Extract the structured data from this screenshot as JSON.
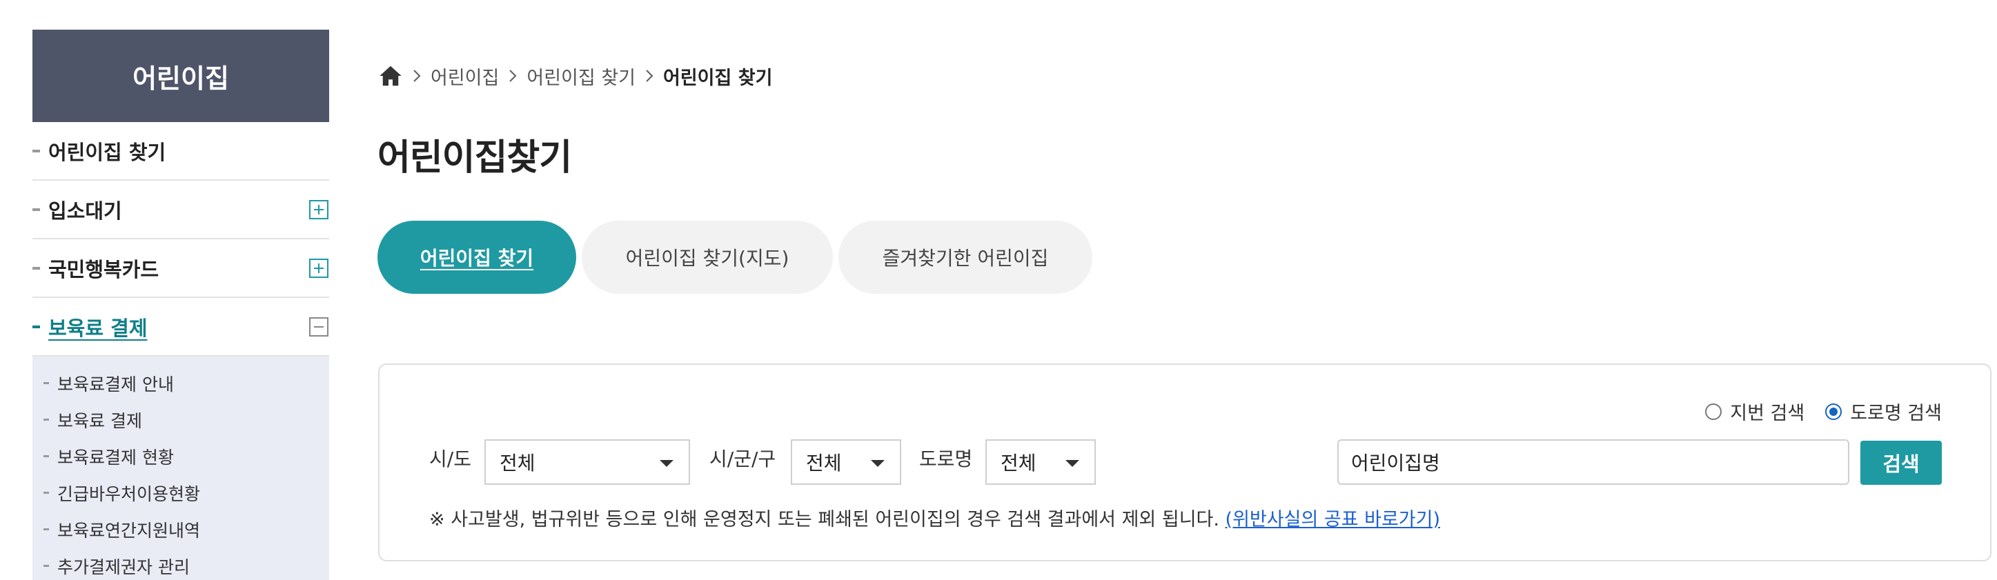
{
  "sidebar": {
    "title": "어린이집",
    "items": [
      {
        "label": "어린이집 찾기"
      },
      {
        "label": "입소대기"
      },
      {
        "label": "국민행복카드"
      },
      {
        "label": "보육료 결제"
      }
    ],
    "submenu": [
      {
        "label": "보육료결제 안내"
      },
      {
        "label": "보육료 결제"
      },
      {
        "label": "보육료결제 현황"
      },
      {
        "label": "긴급바우처이용현황"
      },
      {
        "label": "보육료연간지원내역"
      },
      {
        "label": "추가결제권자 관리"
      }
    ]
  },
  "breadcrumb": {
    "items": [
      "어린이집",
      "어린이집 찾기",
      "어린이집 찾기"
    ]
  },
  "page": {
    "title": "어린이집찾기"
  },
  "tabs": [
    {
      "label": "어린이집 찾기"
    },
    {
      "label": "어린이집 찾기(지도)"
    },
    {
      "label": "즐겨찾기한 어린이집"
    }
  ],
  "search": {
    "radio_lot": "지번 검색",
    "radio_road": "도로명 검색",
    "sido_label": "시/도",
    "sido_value": "전체",
    "sigungu_label": "시/군/구",
    "sigungu_value": "전체",
    "road_label": "도로명",
    "road_value": "전체",
    "name_value": "어린이집명",
    "button": "검색",
    "notice_text": "※ 사고발생, 법규위반 등으로 인해 운영정지 또는 폐쇄된 어린이집의 경우 검색 결과에서 제외 됩니다. ",
    "notice_link": "(위반사실의 공표 바로가기)"
  },
  "colors": {
    "sidebar_header": "#4f5569",
    "accent": "#1f9aa2",
    "link": "#1a5fd0"
  },
  "icons": {
    "home": "home-icon",
    "chevron": "chevron-right-icon",
    "plus": "plus-square-icon",
    "minus": "minus-square-icon",
    "caret": "caret-down-icon"
  }
}
